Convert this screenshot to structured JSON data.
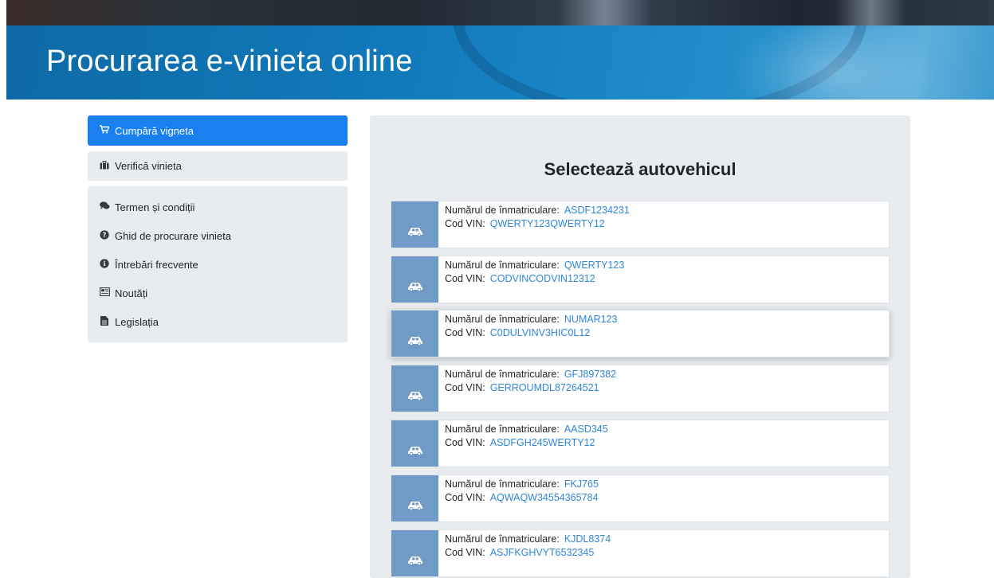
{
  "header": {
    "title": "Procurarea e-vinieta online"
  },
  "sidebar": {
    "active": {
      "label": "Cumpără vigneta",
      "icon": "cart-icon"
    },
    "single": {
      "label": "Verifică vinieta",
      "icon": "briefcase-icon"
    },
    "items": [
      {
        "label": "Termen și condiții",
        "icon": "comments-icon"
      },
      {
        "label": "Ghid de procurare vinieta",
        "icon": "question-circle-icon"
      },
      {
        "label": "Întrebări frecvente",
        "icon": "info-circle-icon"
      },
      {
        "label": "Noutăți",
        "icon": "newspaper-icon"
      },
      {
        "label": "Legislația",
        "icon": "file-icon"
      }
    ]
  },
  "panel": {
    "title": "Selectează autovehicul",
    "plate_label": "Numărul de înmatriculare:",
    "vin_label": "Cod VIN:",
    "vehicles": [
      {
        "plate": "ASDF1234231",
        "vin": "QWERTY123QWERTY12"
      },
      {
        "plate": "QWERTY123",
        "vin": "CODVINCODVIN12312"
      },
      {
        "plate": "NUMAR123",
        "vin": "C0DULVINV3HIC0L12"
      },
      {
        "plate": "GFJ897382",
        "vin": "GERROUMDL87264521"
      },
      {
        "plate": "AASD345",
        "vin": "ASDFGH245WERTY12"
      },
      {
        "plate": "FKJ765",
        "vin": "AQWAQW34554365784"
      },
      {
        "plate": "KJDL8374",
        "vin": "ASJFKGHVYT6532345"
      }
    ]
  },
  "colors": {
    "accent": "#1a80f0",
    "link": "#2f86d9",
    "car_cell": "#6f9bc6",
    "panel_bg": "#e9ecef"
  }
}
